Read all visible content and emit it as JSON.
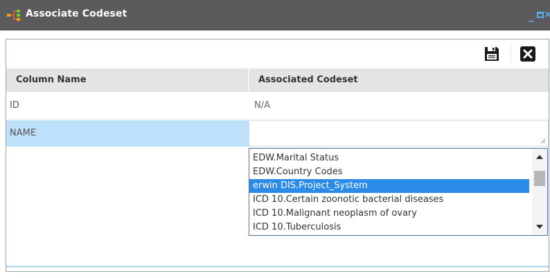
{
  "window": {
    "title": "Associate Codeset",
    "controls": {
      "minimize": "_",
      "close": "✕"
    }
  },
  "toolbar": {
    "save_icon": "floppy-disk-icon",
    "close_icon": "close-x-icon"
  },
  "grid": {
    "columns": [
      "Column Name",
      "Associated Codeset"
    ],
    "rows": [
      {
        "column_name": "ID",
        "codeset": "N/A"
      },
      {
        "column_name": "NAME",
        "codeset": ""
      }
    ]
  },
  "dropdown": {
    "options": [
      "EDW.Marital Status",
      "EDW.Country Codes",
      "erwin DIS.Project_System",
      "ICD 10.Certain zoonotic bacterial diseases",
      "ICD 10.Malignant neoplasm of ovary",
      "ICD 10.Tuberculosis"
    ],
    "selected_index": 2,
    "scroll_position": 0.25
  },
  "colors": {
    "titlebar": "#5b5b5e",
    "window_control": "#5aaef0",
    "selected_row": "#bde0fb",
    "selected_option": "#2a8be8",
    "header": "#e4e4e4"
  }
}
